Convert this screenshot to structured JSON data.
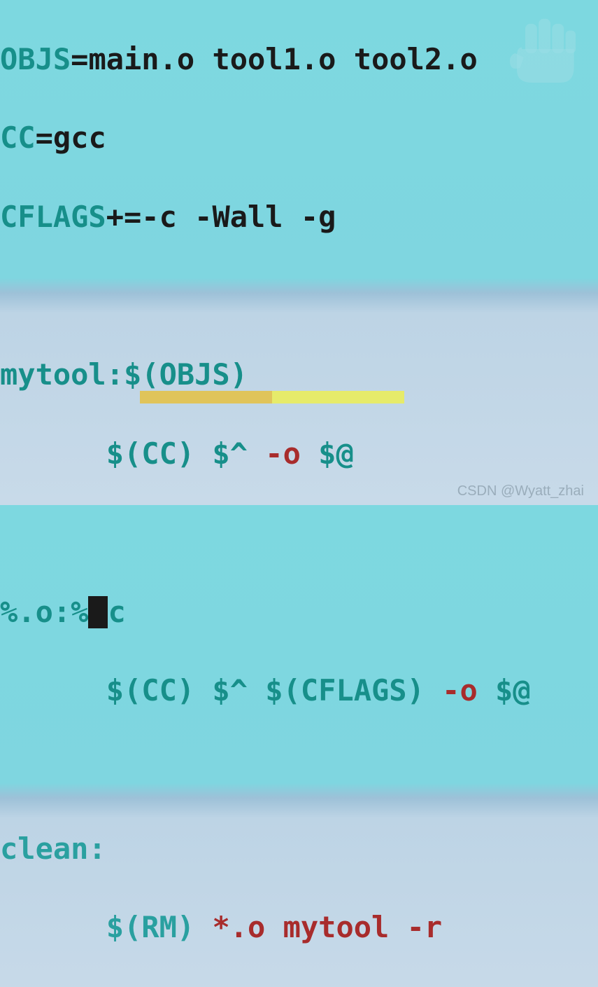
{
  "code": {
    "line1_var": "OBJS",
    "line1_eq": "=",
    "line1_val": "main.o tool1.o tool2.o",
    "line2_var": "CC",
    "line2_eq": "=",
    "line2_val": "gcc",
    "line3_var": "CFLAGS",
    "line3_eq": "+=",
    "line3_val": "-c -Wall -g",
    "line5_rule": "mytool:$(OBJS)",
    "line6_indent": "      ",
    "line6_cc": "$(CC) $^ ",
    "line6_flag": "-o",
    "line6_out": " $@",
    "line8_pre": "%.o:%",
    "line8_post": "c",
    "line9_indent": "      ",
    "line9_cc": "$(CC) $^ $(CFLAGS) ",
    "line9_flag": "-o",
    "line9_out": " $@",
    "line11_rule": "clean:",
    "line12_indent": "      ",
    "line12_rm": "$(RM) ",
    "line12_args": "*.o mytool -r"
  },
  "watermark_text": "CSDN @Wyatt_zhai"
}
